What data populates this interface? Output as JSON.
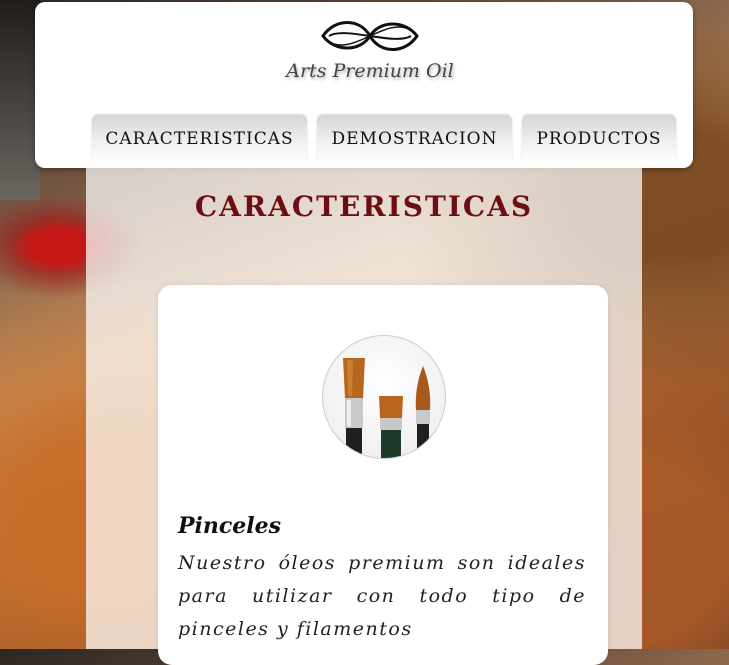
{
  "header": {
    "logo_text": "Arts Premium Oil"
  },
  "nav": {
    "items": [
      {
        "label": "CARACTERISTICAS"
      },
      {
        "label": "DEMOSTRACION"
      },
      {
        "label": "PRODUCTOS"
      }
    ]
  },
  "main": {
    "title": "CARACTERISTICAS",
    "card": {
      "title": "Pinceles",
      "text": "Nuestro óleos premium son ideales para utilizar con todo tipo de pinceles y filamentos"
    }
  },
  "colors": {
    "title_color": "#6b0f12",
    "nav_bg": "#e6e6e6"
  },
  "icons": {
    "logo": "flourish-logo-icon",
    "card_image": "paint-brushes-image"
  }
}
